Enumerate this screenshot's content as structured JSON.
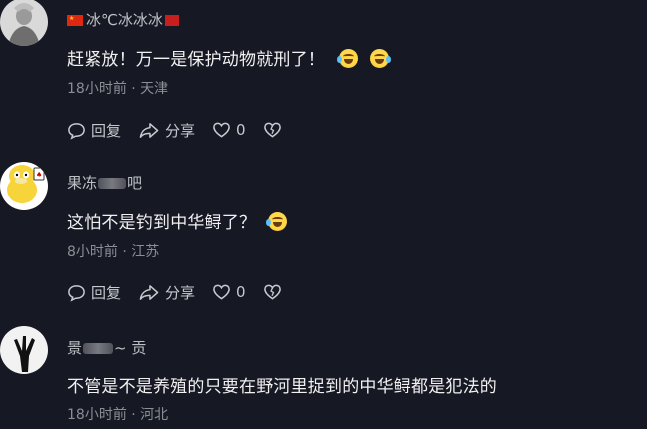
{
  "comments": [
    {
      "username_visible": "冰℃冰冰冰",
      "text": "赶紧放！万一是保护动物就刑了！",
      "meta": "18小时前 · 天津",
      "reply_label": "回复",
      "share_label": "分享",
      "like_count": "0"
    },
    {
      "username_visible": "果冻",
      "username_tail": "吧",
      "text": "这怕不是钓到中华鲟了？",
      "meta": "8小时前 · 江苏",
      "reply_label": "回复",
      "share_label": "分享",
      "like_count": "0"
    },
    {
      "username_visible": "景",
      "username_tail": "~ 贡",
      "text": "不管是不是养殖的只要在野河里捉到的中华鲟都是犯法的",
      "meta": "18小时前 · 河北"
    }
  ],
  "colors": {
    "background": "#161823",
    "text": "#f1f1f2",
    "meta": "#8d8e95",
    "actions": "#c8c9ce"
  },
  "icons": [
    "reply-icon",
    "share-icon",
    "like-icon",
    "dislike-icon",
    "laugh-cry-emoji"
  ]
}
